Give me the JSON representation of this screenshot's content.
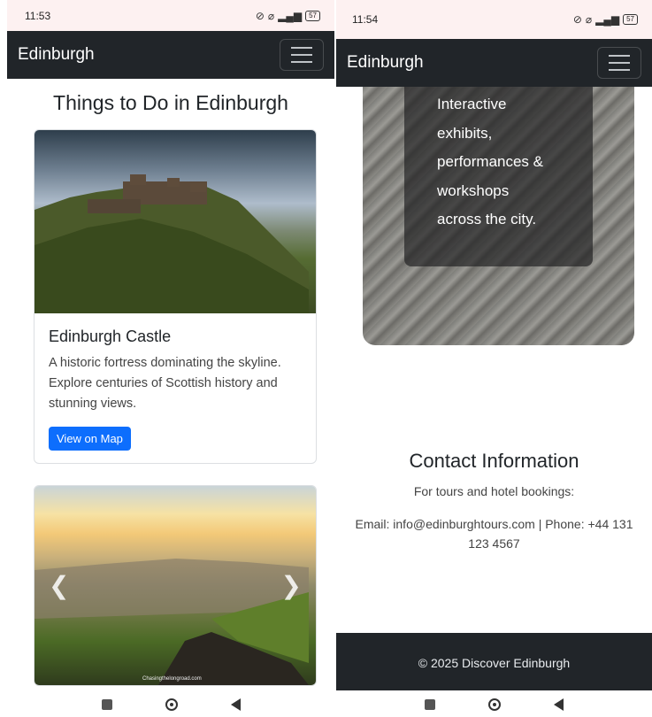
{
  "left": {
    "status": {
      "time": "11:53",
      "battery": "57"
    },
    "navbar": {
      "brand": "Edinburgh"
    },
    "heading": "Things to Do in Edinburgh",
    "cards": [
      {
        "title": "Edinburgh Castle",
        "text": "A historic fortress dominating the skyline. Explore centuries of Scottish history and stunning views.",
        "button": "View on Map"
      }
    ],
    "carousel": {
      "credit": "Chasingthelongroad.com",
      "prev_icon": "chevron-left-icon",
      "next_icon": "chevron-right-icon"
    }
  },
  "right": {
    "status": {
      "time": "11:54",
      "battery": "57"
    },
    "navbar": {
      "brand": "Edinburgh"
    },
    "festival_lines": [
      "Interactive",
      "exhibits,",
      "performances &",
      "workshops",
      "across the city."
    ],
    "contact": {
      "title": "Contact Information",
      "subtitle": "For tours and hotel bookings:",
      "details": "Email: info@edinburghtours.com | Phone: +44 131 123 4567"
    },
    "footer": "© 2025 Discover Edinburgh"
  },
  "colors": {
    "navbar": "#212529",
    "primary_button": "#0d6efd",
    "statusbar": "#fdf1f1"
  }
}
